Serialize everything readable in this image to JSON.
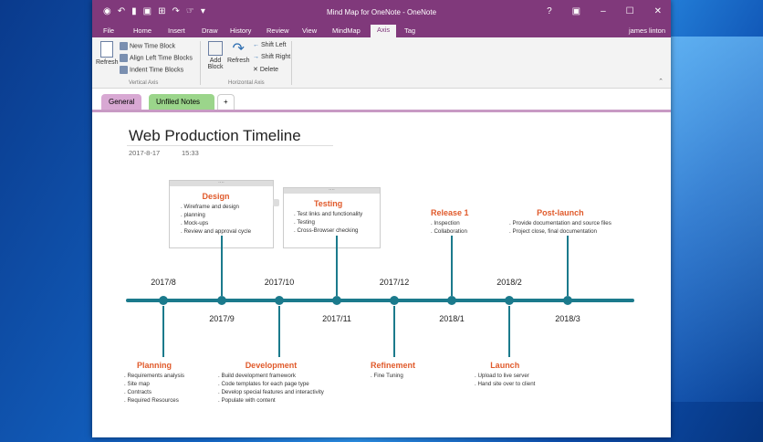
{
  "window": {
    "title": "Mind Map for OneNote - OneNote",
    "user": "james linton",
    "help": "?",
    "minimize": "–",
    "maximize": "☐",
    "close": "✕"
  },
  "menu": [
    "File",
    "Home",
    "Insert",
    "Draw",
    "History",
    "Review",
    "View",
    "MindMap",
    "Axis",
    "Tag"
  ],
  "ribbon": {
    "refresh": "Refresh",
    "new_time_block": "New Time Block",
    "align_left": "Align Left Time Blocks",
    "indent": "Indent Time Blocks",
    "vertical_axis": "Vertical Axis",
    "add_block": "Add Block",
    "refresh2": "Refresh",
    "shift_left": "Shift Left",
    "shift_right": "Shift Right",
    "delete": "Delete",
    "horizontal_axis": "Horizontal Axis"
  },
  "sections": {
    "general": "General",
    "unfiled": "Unfiled Notes",
    "add": "+"
  },
  "page": {
    "title": "Web Production Timeline",
    "date": "2017-8-17",
    "time": "15:33"
  },
  "timeline": {
    "months": [
      "2017/8",
      "2017/9",
      "2017/10",
      "2017/11",
      "2017/12",
      "2018/1",
      "2018/2",
      "2018/3"
    ],
    "events": [
      {
        "title": "Design",
        "items": [
          ". Wireframe and design",
          ". planning",
          ". Mock-ups",
          ". Review and approval cycle"
        ]
      },
      {
        "title": "Testing",
        "items": [
          ". Test links and functionality",
          ". Testing",
          ". Cross-Browser checking"
        ]
      },
      {
        "title": "Release 1",
        "items": [
          ". Inspection",
          ". Collaboration"
        ]
      },
      {
        "title": "Post-launch",
        "items": [
          ". Provide documentation and source files",
          ". Project close, final documentation"
        ]
      },
      {
        "title": "Planning",
        "items": [
          ". Requirements analysis",
          ". Site map",
          ". Contracts",
          ". Required Resources"
        ]
      },
      {
        "title": "Development",
        "items": [
          ". Build development framework",
          ". Code templates for each page type",
          ". Develop special features and interactivity",
          ". Populate with content"
        ]
      },
      {
        "title": "Refinement",
        "items": [
          ". Fine Tuning"
        ]
      },
      {
        "title": "Launch",
        "items": [
          ". Upload to live server",
          ". Hand site over to client"
        ]
      }
    ]
  }
}
